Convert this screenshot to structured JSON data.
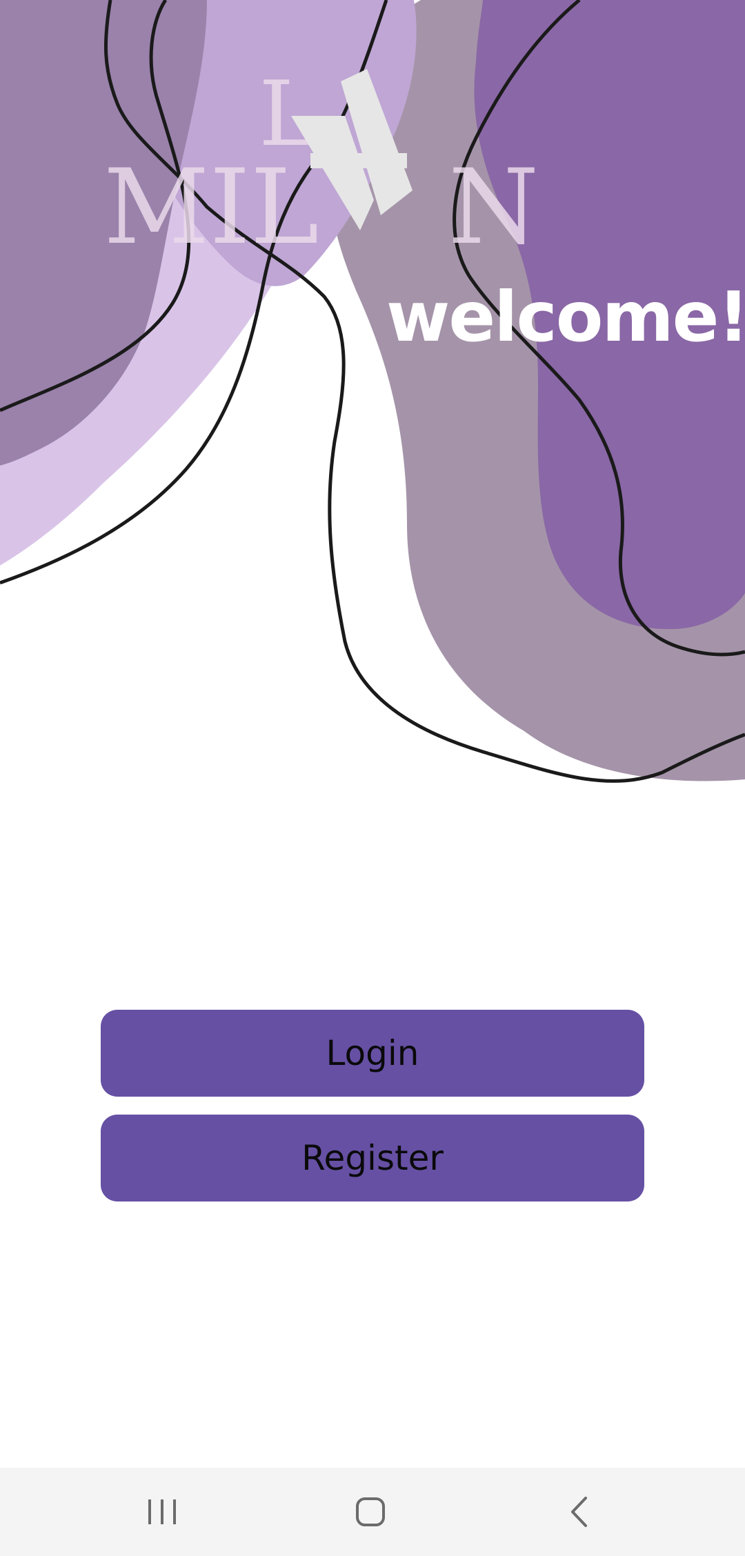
{
  "welcome": {
    "text": "welcome!"
  },
  "logo": {
    "alt": "LA MILAN logo"
  },
  "buttons": {
    "login_label": "Login",
    "register_label": "Register"
  },
  "navbar": {
    "recents_icon": "recents-icon",
    "home_icon": "home-icon",
    "back_icon": "back-icon"
  },
  "colors": {
    "button": "#6650a4",
    "purple_dark": "#8a67a6",
    "purple_mid": "#a594a9",
    "purple_light": "#bfa6d4",
    "purple_pale": "#d9c4e8",
    "navbar_bg": "#f4f4f4"
  }
}
